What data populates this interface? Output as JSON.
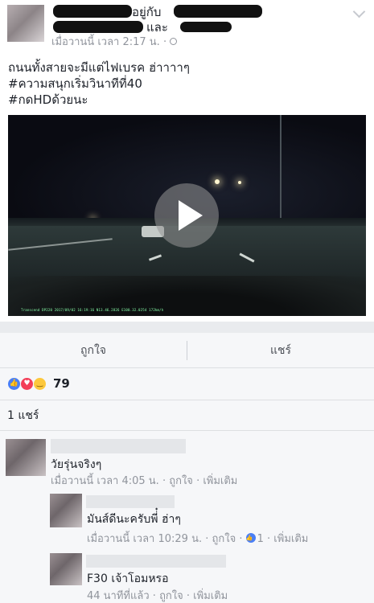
{
  "post": {
    "header": {
      "with_label": "อยู่กับ",
      "and_label": "และ",
      "timestamp": "เมื่อวานนี้ เวลา 2:17 น. ·"
    },
    "text_lines": [
      "ถนนทั้งสายจะมีแต่ไฟเบรค ฮ่าาาาๆ",
      "#ความสนุกเริ่มวินาทีที่40",
      "#กดHDด้วยนะ"
    ],
    "video": {
      "overlay_text": "Transcend DP220  2017/09/02 16:19:16  N13.46.2826 E100.32.0254 172km/h"
    }
  },
  "actions": {
    "like_label": "ถูกใจ",
    "share_label": "แชร์"
  },
  "reactions": {
    "icons": [
      "like-icon",
      "love-icon",
      "haha-icon"
    ],
    "count": "79"
  },
  "shares": {
    "text": "1 แชร์"
  },
  "comments": [
    {
      "text": "วัยรุ่นจริงๆ",
      "time": "เมื่อวานนี้ เวลา 4:05 น. ·",
      "like": "ถูกใจ",
      "more": "· เพิ่มเติม"
    },
    {
      "text": "มันส์ดีนะครับพี่๋ ฮ่าๆ",
      "time": "เมื่อวานนี้ เวลา 10:29 น. ·",
      "like": "ถูกใจ ·",
      "like_count": "1",
      "more": "· เพิ่มเติม"
    },
    {
      "text": "F30 เจ้าโอมหรอ",
      "time": "44 นาทีที่แล้ว ·",
      "like": "ถูกใจ",
      "more": "· เพิ่มเติม"
    }
  ],
  "colors": {
    "text": "#1d2129",
    "meta": "#90949c",
    "like_blue": "#4a7ff5",
    "love_red": "#f33e58",
    "haha_yellow": "#fdc83c",
    "panel_bg": "#f6f7f9"
  }
}
